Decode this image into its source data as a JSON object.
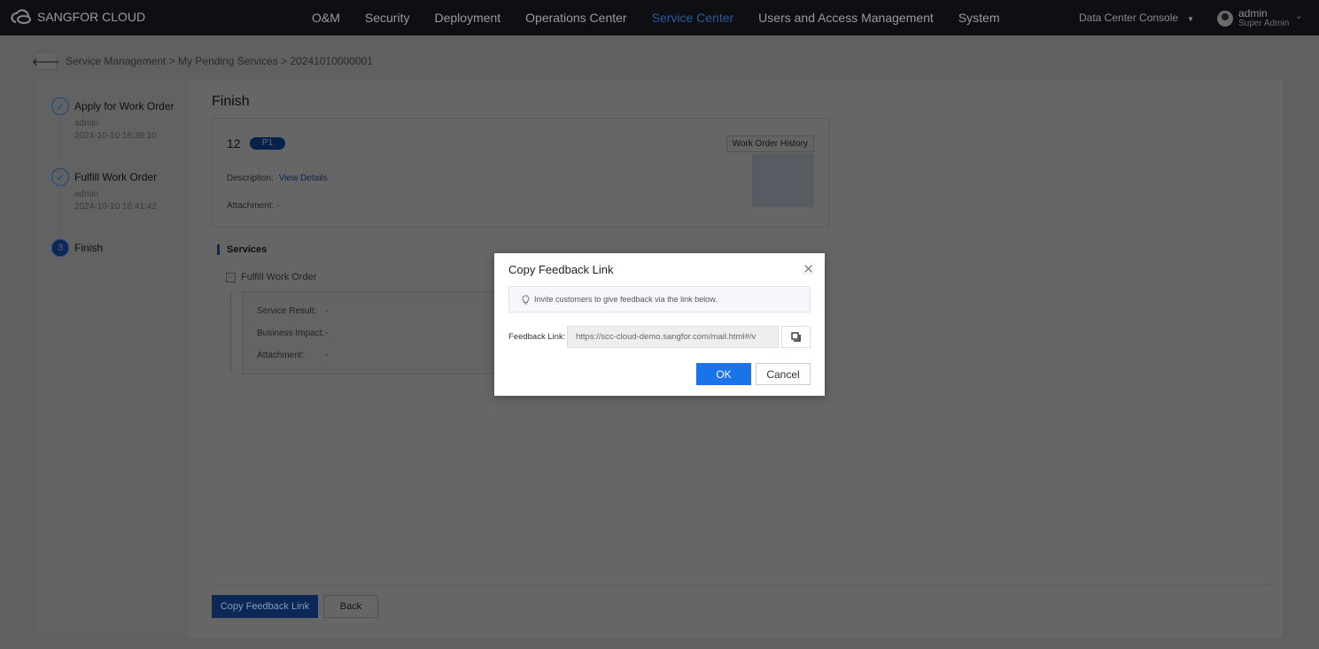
{
  "nav": {
    "brand": "SANGFOR CLOUD",
    "items": [
      "O&M",
      "Security",
      "Deployment",
      "Operations Center",
      "Service Center",
      "Users and Access Management",
      "System"
    ],
    "active": "Service Center",
    "console": "Data Center Console",
    "user": "admin",
    "role": "Super Admin"
  },
  "breadcrumb": [
    "Service Management",
    "My Pending Services",
    "20241010000001"
  ],
  "steps": [
    {
      "title": "Apply for Work Order",
      "user": "admin",
      "time": "2024-10-10 16:39:10"
    },
    {
      "title": "Fulfill Work Order",
      "user": "admin",
      "time": "2024-10-10 16:41:42"
    },
    {
      "number": "3",
      "title": "Finish"
    }
  ],
  "content": {
    "title": "Finish",
    "order_id": "12",
    "priority": "P1",
    "history_button": "Work Order History",
    "description_label": "Description:",
    "description_link": "View Details",
    "attachment_label": "Attachment:",
    "attachment_value": "-",
    "services_heading": "Services",
    "service_name": "Fulfill Work Order",
    "service_fields": [
      {
        "label": "Service Result:",
        "value": "-"
      },
      {
        "label": "Business Impact:",
        "value": "-"
      },
      {
        "label": "Attachment:",
        "value": "-"
      }
    ]
  },
  "footer": {
    "copy_button": "Copy Feedback Link",
    "back_button": "Back"
  },
  "modal": {
    "title": "Copy Feedback Link",
    "tip": "Invite customers to give feedback via the link below.",
    "link_label": "Feedback Link:",
    "link_value": "https://scc-cloud-demo.sangfor.com/mail.html#/v",
    "ok": "OK",
    "cancel": "Cancel"
  },
  "colors": {
    "accent": "#1a73e8",
    "nav_bg": "#1f232b",
    "active_nav": "#4a8ef0"
  }
}
